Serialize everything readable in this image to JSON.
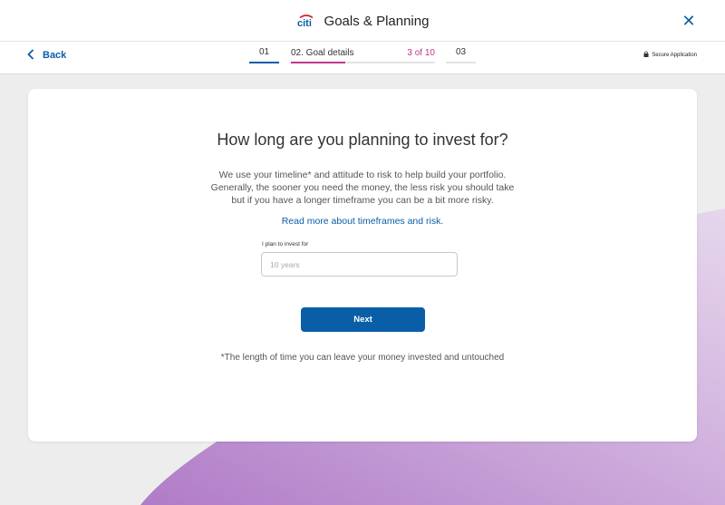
{
  "header": {
    "logo_text": "citi",
    "title": "Goals & Planning",
    "close_icon": "close-icon"
  },
  "nav": {
    "back_label": "Back",
    "steps": [
      {
        "label": "01"
      },
      {
        "label": "02. Goal details",
        "counter": "3 of 10",
        "progress": 0.38
      },
      {
        "label": "03"
      }
    ],
    "secure_label": "Secure Application"
  },
  "card": {
    "question": "How long are you planning to invest for?",
    "intro": "We use your timeline* and attitude to risk to help build your portfolio. Generally, the sooner you need the money, the less risk you should take but if you have a longer timeframe you can be a bit more risky.",
    "read_more": "Read more about timeframes and risk.",
    "input": {
      "label": "I plan to invest for",
      "placeholder": "10 years",
      "value": ""
    },
    "next_label": "Next",
    "footnote": "*The length of time you can leave your money invested and untouched"
  },
  "colors": {
    "primary": "#0a5ea8",
    "accent": "#c0368e",
    "background": "#ededed"
  }
}
